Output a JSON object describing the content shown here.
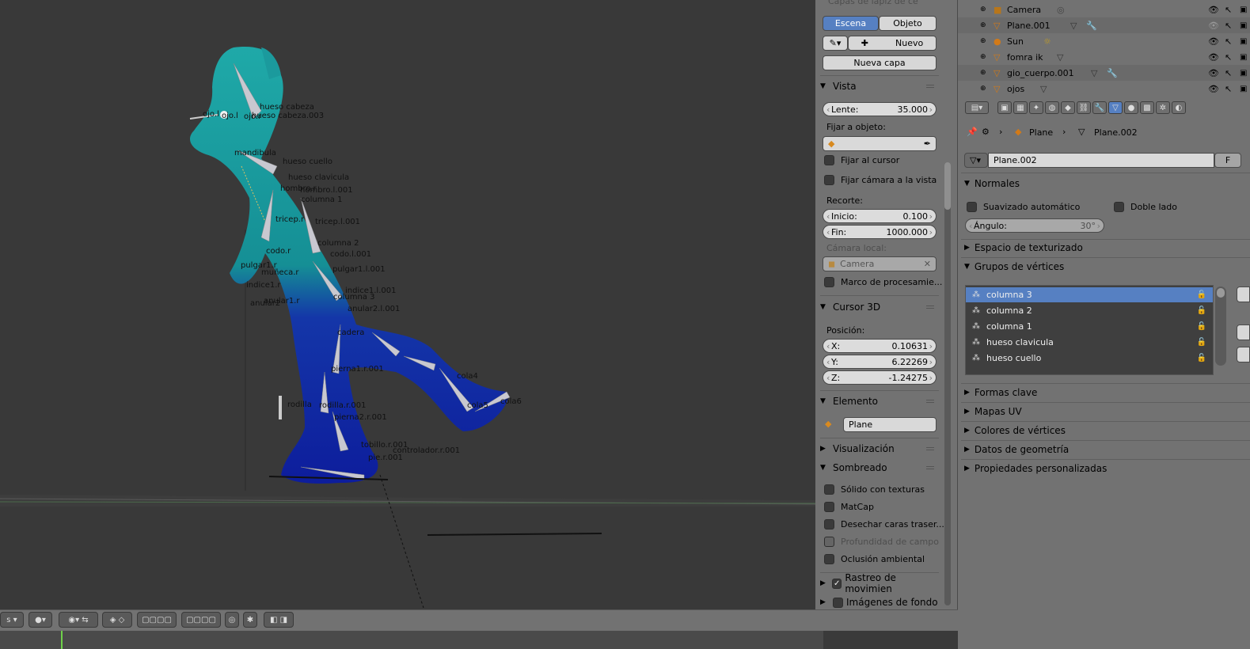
{
  "viewport": {
    "bone_labels": [
      "hueso cabeza",
      "hueso cabeza.003",
      "ojo.l",
      "ojo.l",
      "ojo.r",
      "mandibula",
      "hueso cuello",
      "hueso clavicula",
      "hombro.l.001",
      "hombro.r",
      "columna 1",
      "tricep.r",
      "tricep.l.001",
      "columna 2",
      "codo.l.001",
      "codo.r",
      "muñeca.r",
      "pulgar1.r",
      "indice1.r",
      "anular1.r",
      "anular2",
      "columna 3",
      "cadera",
      "pierna1.r.001",
      "rodilla.r.001",
      "rodilla",
      "pierna2.r.001",
      "tobillo.r.001",
      "controlador.r.001",
      "pie.r.001",
      "cola4",
      "cola5",
      "cola6",
      "pulgar1.l.001",
      "indice1.l.001",
      "anular2.l.001"
    ]
  },
  "n_panel": {
    "top_label": "Capas de lápiz de ce",
    "scene_tab": "Escena",
    "object_tab": "Objeto",
    "new_label": "Nuevo",
    "new_layer": "Nueva capa",
    "view_header": "Vista",
    "lens_label": "Lente:",
    "lens_value": "35.000",
    "lock_object": "Fijar a objeto:",
    "lock_cursor": "Fijar al cursor",
    "lock_cam": "Fijar cámara a la vista",
    "clip_label": "Recorte:",
    "start_label": "Inicio:",
    "start_value": "0.100",
    "end_label": "Fin:",
    "end_value": "1000.000",
    "local_cam": "Cámara local:",
    "camera_field": "Camera",
    "render_border": "Marco de procesamie...",
    "cursor_header": "Cursor 3D",
    "position": "Posición:",
    "x_label": "X:",
    "x_value": "0.10631",
    "y_label": "Y:",
    "y_value": "6.22269",
    "z_label": "Z:",
    "z_value": "-1.24275",
    "item_header": "Elemento",
    "item_name": "Plane",
    "display_header": "Visualización",
    "shading_header": "Sombreado",
    "textured_solid": "Sólido con texturas",
    "matcap": "MatCap",
    "backface": "Desechar caras traser...",
    "dof": "Profundidad de campo",
    "ao": "Oclusión ambiental",
    "motion_tracking": "Rastreo de movimien",
    "background_images": "Imágenes de fondo"
  },
  "outliner": {
    "rows": [
      {
        "name": "Camera"
      },
      {
        "name": "Plane.001"
      },
      {
        "name": "Sun"
      },
      {
        "name": "fomra ik"
      },
      {
        "name": "gio_cuerpo.001"
      },
      {
        "name": "ojos"
      }
    ]
  },
  "properties": {
    "breadcrumb_object": "Plane",
    "breadcrumb_data": "Plane.002",
    "datablock_name": "Plane.002",
    "datablock_fake": "F",
    "normals_header": "Normales",
    "auto_smooth": "Suavizado automático",
    "double_sided": "Doble lado",
    "angle_label": "Ángulo:",
    "angle_value": "30°",
    "texture_space": "Espacio de texturizado",
    "vertex_groups": "Grupos de vértices",
    "groups": [
      "columna 3",
      "columna 2",
      "columna 1",
      "hueso clavicula",
      "hueso cuello"
    ],
    "shape_keys": "Formas clave",
    "uv_maps": "Mapas UV",
    "vertex_colors": "Colores de vértices",
    "geometry_data": "Datos de geometría",
    "custom_props": "Propiedades personalizadas"
  },
  "bottom": {
    "mode_label": "s"
  },
  "colors": {
    "selected": "#5680c2",
    "panel": "#727272",
    "viewport": "#393939",
    "mesh_teal": "#1a9ea0",
    "mesh_blue": "#1020a8"
  }
}
